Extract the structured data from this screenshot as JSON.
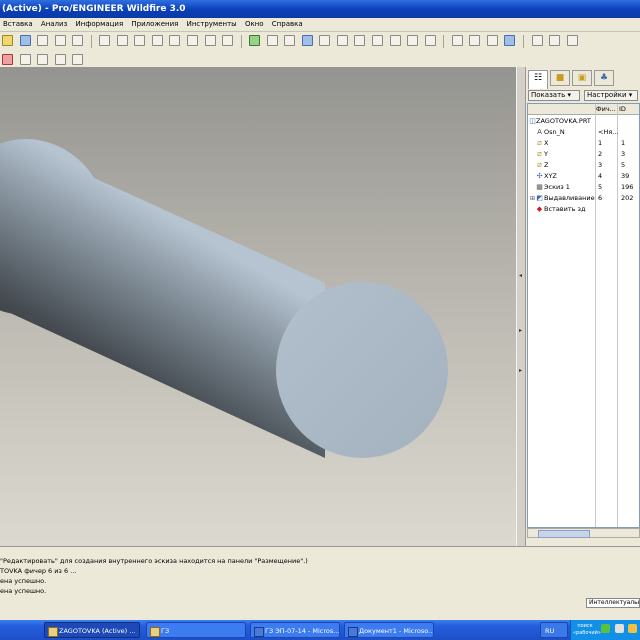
{
  "window": {
    "title": "(Active) - Pro/ENGINEER Wildfire 3.0"
  },
  "menu": [
    "Вставка",
    "Анализ",
    "Информация",
    "Приложения",
    "Инструменты",
    "Окно",
    "Справка"
  ],
  "navigator": {
    "show_label": "Показать ▾",
    "settings_label": "Настройки ▾",
    "columns": {
      "feature": "Фич...",
      "id": "ID"
    },
    "tree": [
      {
        "icon": "part-icon",
        "name": "ZAGOTOVKA.PRT",
        "num": "",
        "id": ""
      },
      {
        "icon": "annotation-icon",
        "name": "Osn_N",
        "num": "<Ня...",
        "id": ""
      },
      {
        "icon": "datum-plane-icon",
        "name": "X",
        "num": "1",
        "id": "1"
      },
      {
        "icon": "datum-plane-icon",
        "name": "Y",
        "num": "2",
        "id": "3"
      },
      {
        "icon": "datum-plane-icon",
        "name": "Z",
        "num": "3",
        "id": "5"
      },
      {
        "icon": "coord-system-icon",
        "name": "XYZ",
        "num": "4",
        "id": "39"
      },
      {
        "icon": "sketch-icon",
        "name": "Эскиз 1",
        "num": "5",
        "id": "196"
      },
      {
        "icon": "extrude-icon",
        "name": "Выдавливание",
        "num": "6",
        "id": "202"
      },
      {
        "icon": "insert-here-icon",
        "name": "Вставить зд",
        "num": "",
        "id": ""
      }
    ]
  },
  "messages": [
    "\"Редактировать\" для создания внутреннего эскиза находится на панели \"Размещение\".)",
    "ТОVKA фичер 6 из 6 ...",
    "ена успешно.",
    "",
    "ена успешно."
  ],
  "filter": {
    "value": "Интеллектуальн"
  },
  "taskbar": {
    "tasks": [
      "ZAGOTOVKA (Active) ...",
      "ГЗ",
      "ГЗ ЭП-07-14 - Micros...",
      "Документ1 - Microso...",
      "RU"
    ],
    "tray_text": [
      "поиск",
      "«рабочий»"
    ]
  },
  "colors": {
    "titlebar": "#0a3fb8",
    "cylinder_light": "#b6c4d2",
    "cylinder_dark": "#323638",
    "cap": "#aab8c6"
  }
}
